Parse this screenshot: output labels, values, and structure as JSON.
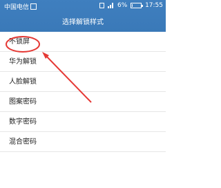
{
  "status_bar": {
    "carrier": "中国电信",
    "battery": "6%",
    "battery_level": 0.06,
    "time": "17:55"
  },
  "header": {
    "title": "选择解锁样式"
  },
  "unlock_options": [
    {
      "label": "不锁屏"
    },
    {
      "label": "华为解锁"
    },
    {
      "label": "人脸解锁"
    },
    {
      "label": "图案密码"
    },
    {
      "label": "数字密码"
    },
    {
      "label": "混合密码"
    }
  ],
  "annotation": {
    "color": "#e53935",
    "highlighted_item": "不锁屏"
  }
}
